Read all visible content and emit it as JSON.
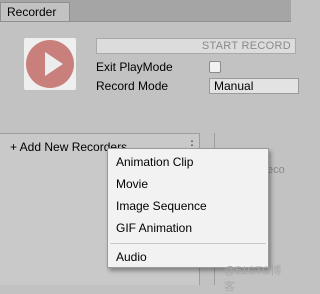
{
  "window": {
    "tab_label": "Recorder"
  },
  "header": {
    "start_button": "START RECORD",
    "exit_playmode_label": "Exit PlayMode",
    "exit_playmode_checked": false,
    "record_mode_label": "Record Mode",
    "record_mode_value": "Manual"
  },
  "recorders": {
    "add_button": "+ Add New Recorders",
    "kebab": "⋮",
    "right_pane_fragment": "eco"
  },
  "context_menu": {
    "items": [
      "Animation Clip",
      "Movie",
      "Image Sequence",
      "GIF Animation",
      "Audio"
    ]
  },
  "watermark": "@51CTO博客",
  "colors": {
    "play_button": "#c9807d"
  }
}
